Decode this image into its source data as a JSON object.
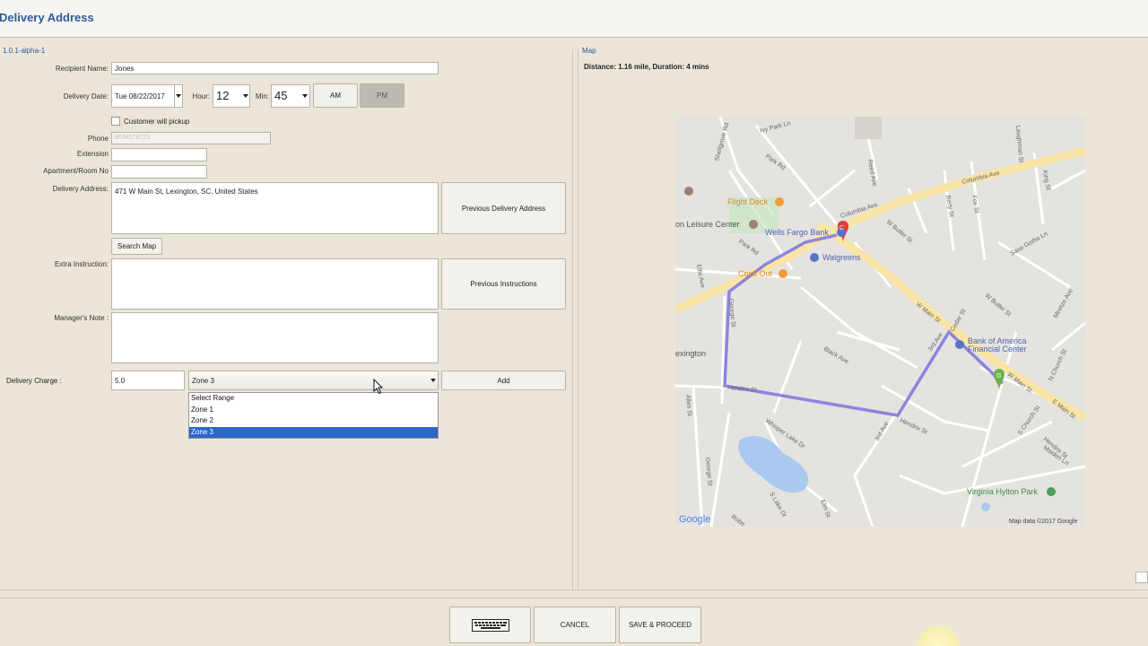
{
  "window": {
    "title": "Delivery Address",
    "version": "1.0.1-alpha-1"
  },
  "form": {
    "recipient_label": "Recipient Name:",
    "recipient_value": "Jones",
    "delivery_date_label": "Delivery Date:",
    "delivery_date_value": "Tue 08/22/2017",
    "hour_label": "Hour:",
    "hour_value": "12",
    "min_label": "Min:",
    "min_value": "45",
    "am_label": "AM",
    "pm_label": "PM",
    "customer_pickup_label": "Customer will pickup",
    "phone_label": "Phone",
    "phone_value": "8034578723",
    "extension_label": "Extension",
    "extension_value": "",
    "apt_label": "Apartment/Room No",
    "apt_value": "",
    "delivery_address_label": "Delivery Address:",
    "delivery_address_value": "471 W Main St, Lexington, SC, United States",
    "previous_delivery_address_button": "Previous Delivery Address",
    "search_map_button": "Search Map",
    "extra_instruction_label": "Extra Instruction:",
    "extra_instruction_value": "",
    "previous_instructions_button": "Previous Instructions",
    "managers_note_label": "Manager's Note :",
    "managers_note_value": "",
    "delivery_charge_label": "Delivery Charge :",
    "delivery_charge_value": "5.0",
    "zone_selected": "Zone 3",
    "zone_options": [
      "Select Range",
      "Zone 1",
      "Zone 2",
      "Zone 3"
    ],
    "add_button": "Add"
  },
  "map": {
    "label": "Map",
    "distance_text": "Distance: 1.16 mile, Duration: 4 mins",
    "places": {
      "flight_deck": "Flight Deck",
      "leisure_center": "on Leisure Center",
      "wells_fargo": "Wells Fargo Bank",
      "walgreens": "Walgreens",
      "cook_out": "Cook Out",
      "bank_of_america_1": "Bank of America",
      "bank_of_america_2": "Financial Center",
      "virginia_hylton": "Virginia Hylton Park",
      "lexington": "exington"
    },
    "streets": {
      "columbia_ave_1": "Columbia Ave",
      "columbia_ave_2": "Columbia Ave",
      "w_main_st_1": "W Main St",
      "w_main_st_2": "W Main St",
      "e_main_st": "E Main St",
      "park_rd_1": "Park Rd",
      "park_rd_2": "Park Rd",
      "hendrix_st_1": "Hendrix St",
      "hendrix_st_2": "Hendrix St",
      "black_ave": "Black Ave",
      "whisper_lake": "Whisper Lake Dr",
      "third_ave_1": "3rd Ave",
      "third_ave_2": "3rd Ave",
      "w_butler_st": "W Butler St",
      "w_butler_st_2": "W Butler St",
      "saxe_gotha": "Saxe Gotha Ln",
      "reed_ave": "Reed Ave",
      "ivy_park": "Ivy Park Ln",
      "meetze_ave": "Meetze Ave",
      "fox_st": "Fox St",
      "berly_st": "Berly St",
      "george_st": "George St",
      "george_st_2": "George St",
      "allen_st": "Allen St",
      "ellis_ave": "Ellis Ave",
      "cedar_st": "Cedar St",
      "n_church_st": "N Church St",
      "s_church_st": "S Church St",
      "hendrix_st_3": "Hendrix St",
      "s_lake": "S Lake Dr",
      "elm_st": "Elm St",
      "robe": "Robe",
      "maiden_ln": "Maiden Ln",
      "king_st": "King St",
      "laughman": "Laughman St",
      "shellgrove": "Shellgrove Rd",
      "main_c": "C",
      "marker_g": "G"
    },
    "attribution": "Map data ©2017 Google",
    "google_logo": "Google",
    "colors": {
      "route": "#7b74e0",
      "major_road": "#f9e6a6",
      "water": "#a9c9f0",
      "park": "#c8e6c0"
    }
  },
  "footer": {
    "keyboard_icon": "keyboard-icon",
    "cancel_button": "CANCEL",
    "save_proceed_button": "SAVE & PROCEED"
  }
}
